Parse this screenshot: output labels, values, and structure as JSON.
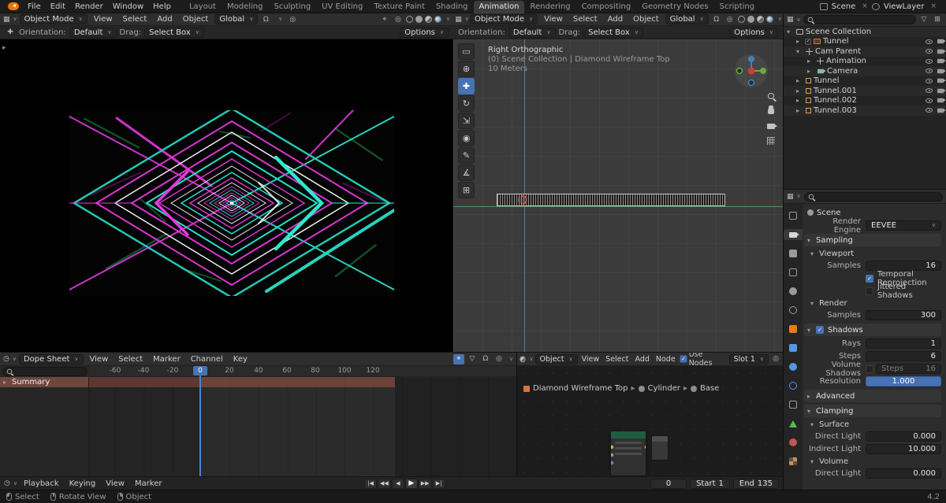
{
  "icons": {
    "chevron": "∨",
    "tri_right": "▸",
    "tri_down": "▾",
    "close": "×",
    "check": "✓",
    "editor_grid": "▦",
    "editor_clock": "◷",
    "funnel": "▽",
    "magnet": "Ω",
    "proportional": "◎",
    "cursor_target": "⌖",
    "tools": [
      "▭",
      "⊕",
      "✚",
      "↻",
      "⇲",
      "◉",
      "✎",
      "∡",
      "⊞"
    ],
    "transport": [
      "|◀",
      "◀◀",
      "◀",
      "▶",
      "▶▶",
      "▶|"
    ]
  },
  "topbar": {
    "menus": [
      "File",
      "Edit",
      "Render",
      "Window",
      "Help"
    ],
    "workspaces": [
      "Layout",
      "Modeling",
      "Sculpting",
      "UV Editing",
      "Texture Paint",
      "Shading",
      "Animation",
      "Rendering",
      "Compositing",
      "Geometry Nodes",
      "Scripting"
    ],
    "active_workspace": "Animation",
    "scene_label": "Scene",
    "viewlayer_label": "ViewLayer"
  },
  "camera_editor": {
    "mode": "Object Mode",
    "menus": [
      "View",
      "Select",
      "Add",
      "Object"
    ],
    "orientation": "Global",
    "tools": {
      "orientation_label": "Orientation:",
      "orientation": "Default",
      "drag_label": "Drag:",
      "drag": "Select Box",
      "options": "Options"
    }
  },
  "viewport_editor": {
    "mode": "Object Mode",
    "menus": [
      "View",
      "Select",
      "Add",
      "Object"
    ],
    "orientation": "Global",
    "tools": {
      "orientation_label": "Orientation:",
      "orientation": "Default",
      "drag_label": "Drag:",
      "drag": "Select Box",
      "options": "Options"
    },
    "overlay": {
      "view": "Right Orthographic",
      "context": "(0) Scene Collection | Diamond Wireframe Top",
      "scale": "10 Meters"
    }
  },
  "outliner": {
    "rows": [
      {
        "label": "Scene Collection"
      },
      {
        "label": "Tunnel"
      },
      {
        "label": "Cam Parent"
      },
      {
        "label": "Animation"
      },
      {
        "label": "Camera"
      },
      {
        "label": "Tunnel"
      },
      {
        "label": "Tunnel.001"
      },
      {
        "label": "Tunnel.002"
      },
      {
        "label": "Tunnel.003"
      }
    ]
  },
  "properties": {
    "breadcrumb": "Scene",
    "sections": {
      "sampling": "Sampling",
      "viewport": "Viewport",
      "render": "Render",
      "shadows": "Shadows",
      "advanced": "Advanced",
      "clamping": "Clamping",
      "surface": "Surface",
      "volume": "Volume"
    },
    "rows": {
      "render_engine": {
        "label": "Render Engine",
        "value": "EEVEE"
      },
      "viewport_samples": {
        "label": "Samples",
        "value": "16"
      },
      "temporal": {
        "label": "Temporal Reprojection"
      },
      "jittered": {
        "label": "Jittered Shadows"
      },
      "render_samples": {
        "label": "Samples",
        "value": "300"
      },
      "rays": {
        "label": "Rays",
        "value": "1"
      },
      "steps": {
        "label": "Steps",
        "value": "6"
      },
      "volume_shadows": {
        "label": "Volume Shadows",
        "steps_label": "Steps",
        "steps_value": "16"
      },
      "resolution": {
        "label": "Resolution",
        "value": "1.000"
      },
      "surface_direct": {
        "label": "Direct Light",
        "value": "0.000"
      },
      "surface_indirect": {
        "label": "Indirect Light",
        "value": "10.000"
      },
      "volume_direct": {
        "label": "Direct Light",
        "value": "0.000"
      }
    }
  },
  "dope_sheet": {
    "editor": "Dope Sheet",
    "menus": [
      "View",
      "Select",
      "Marker",
      "Channel",
      "Key"
    ],
    "channel": "Summary",
    "ticks": [
      "-60",
      "-40",
      "-20",
      "0",
      "20",
      "40",
      "60",
      "80",
      "100",
      "120"
    ],
    "playhead": "0"
  },
  "shader_editor": {
    "type": "Object",
    "menus": [
      "View",
      "Select",
      "Add",
      "Node"
    ],
    "use_nodes": "Use Nodes",
    "slot": "Slot 1",
    "path": [
      "Diamond Wireframe Top",
      "Cylinder",
      "Base"
    ]
  },
  "timeline": {
    "menus": [
      "Playback",
      "Keying",
      "View",
      "Marker"
    ],
    "frame": "0",
    "start_label": "Start",
    "start": "1",
    "end_label": "End",
    "end": "135"
  },
  "status": {
    "items": [
      "Select",
      "Rotate View",
      "Object"
    ],
    "version": "4.2"
  },
  "colors": {
    "accent": "#4772b3",
    "magenta": "#e23ae0",
    "cyan": "#2fe8cf",
    "axis_green": "#5fa55f"
  }
}
